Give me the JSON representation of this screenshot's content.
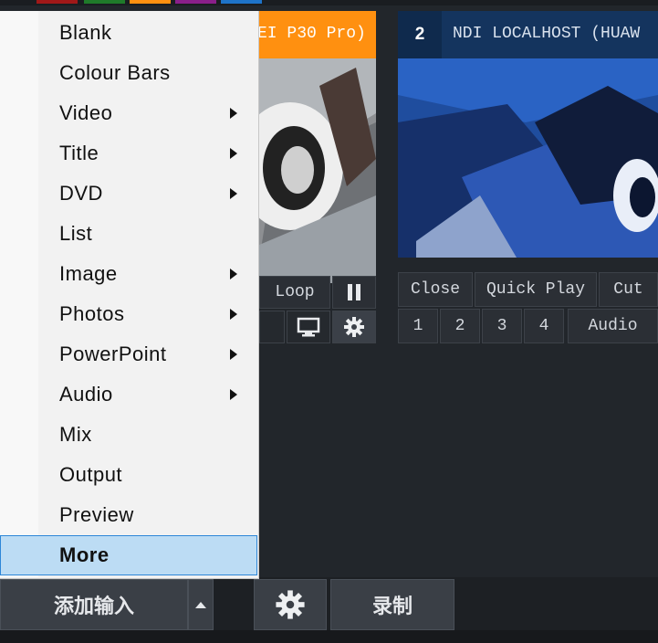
{
  "colors": {
    "panel1_header": "#ff9010",
    "panel2_header": "#14345e",
    "menu_highlight": "#bcdcf4",
    "menu_highlight_border": "#2e87d8",
    "background": "#22262b"
  },
  "context_menu": {
    "items": [
      {
        "label": "Blank",
        "has_submenu": false
      },
      {
        "label": "Colour Bars",
        "has_submenu": false
      },
      {
        "label": "Video",
        "has_submenu": true
      },
      {
        "label": "Title",
        "has_submenu": true
      },
      {
        "label": "DVD",
        "has_submenu": true
      },
      {
        "label": "List",
        "has_submenu": false
      },
      {
        "label": "Image",
        "has_submenu": true
      },
      {
        "label": "Photos",
        "has_submenu": true
      },
      {
        "label": "PowerPoint",
        "has_submenu": true
      },
      {
        "label": "Audio",
        "has_submenu": true
      },
      {
        "label": "Mix",
        "has_submenu": false
      },
      {
        "label": "Output",
        "has_submenu": false
      },
      {
        "label": "Preview",
        "has_submenu": false
      },
      {
        "label": "More",
        "has_submenu": false,
        "highlighted": true
      }
    ]
  },
  "input1": {
    "title": "EI P30 Pro)",
    "loop_label": "Loop",
    "pause_icon": "pause-icon",
    "monitor_icon": "monitor-icon",
    "settings_icon": "gear-icon"
  },
  "input2": {
    "number": "2",
    "title": "NDI LOCALHOST (HUAW",
    "close_label": "Close",
    "quick_play_label": "Quick Play",
    "cut_label": "Cut",
    "overlay_buttons": [
      "1",
      "2",
      "3",
      "4"
    ],
    "audio_label": "Audio"
  },
  "bottom_bar": {
    "add_input_label": "添加输入",
    "settings_icon": "gear-icon",
    "record_label": "录制"
  }
}
